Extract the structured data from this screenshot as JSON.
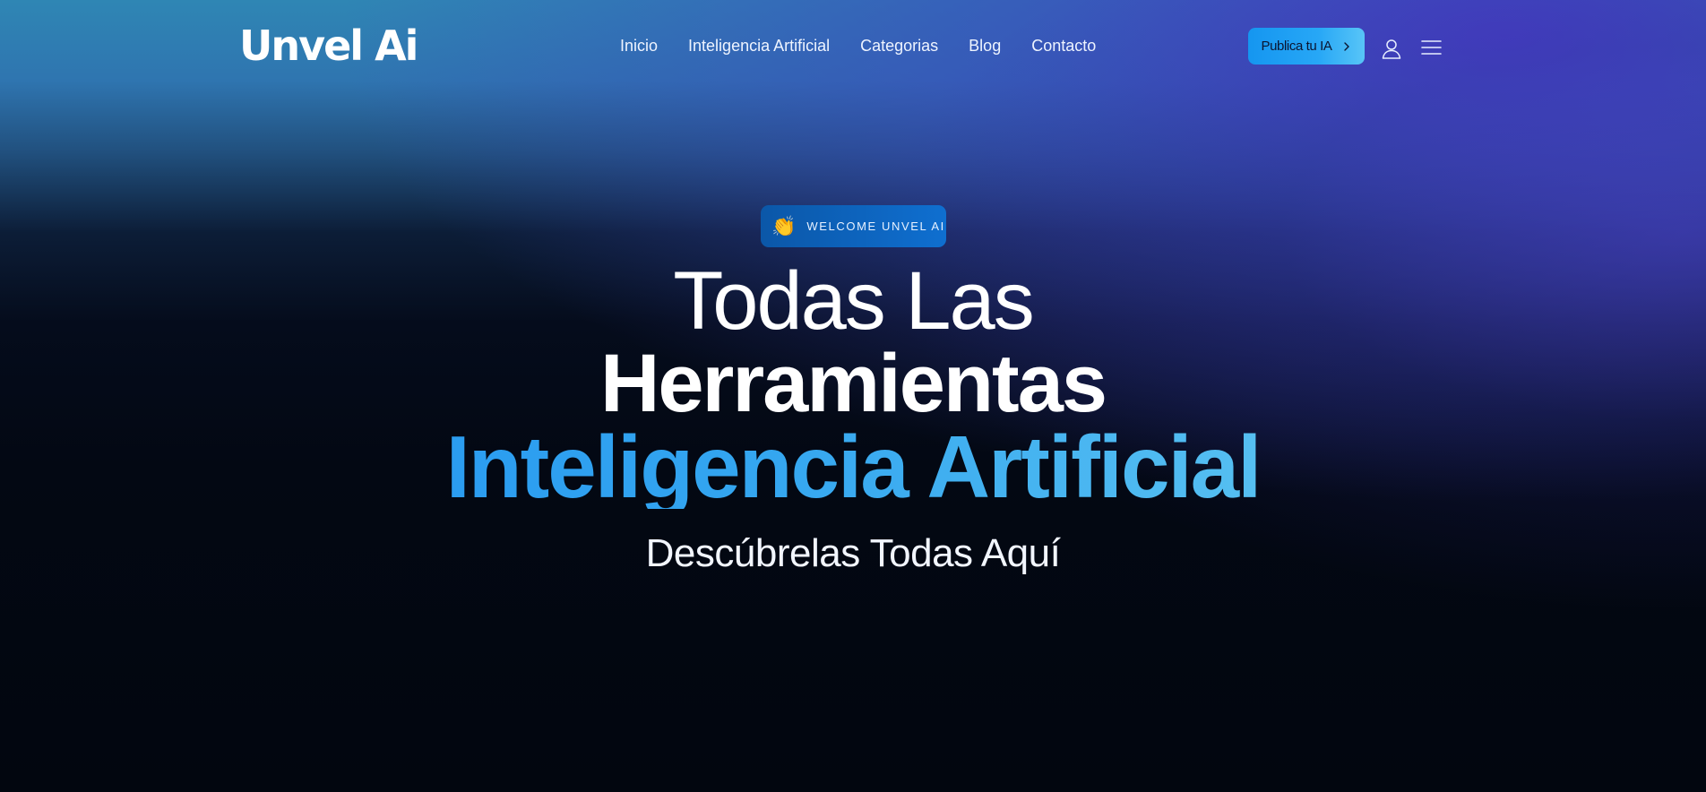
{
  "brand": {
    "logo_text": "Unvel Ai"
  },
  "nav": {
    "items": [
      {
        "label": "Inicio"
      },
      {
        "label": "Inteligencia Artificial"
      },
      {
        "label": "Categorias"
      },
      {
        "label": "Blog"
      },
      {
        "label": "Contacto"
      }
    ],
    "cta_label": "Publica tu IA",
    "icons": [
      "chevron-right-icon",
      "user-icon",
      "hamburger-menu-icon"
    ]
  },
  "hero": {
    "badge_icon": "👏",
    "badge_text": "WELCOME UNVEL AI",
    "headline_line1": "Todas Las",
    "headline_line2": "Herramientas",
    "headline_accent": "Inteligencia Artificial",
    "subtitle": "Descúbrelas Todas Aquí"
  },
  "colors": {
    "accent": "#1596f0",
    "accent_light": "#74d6f2",
    "badge_bg": "#0f6fd0",
    "background_dark": "#030813"
  }
}
